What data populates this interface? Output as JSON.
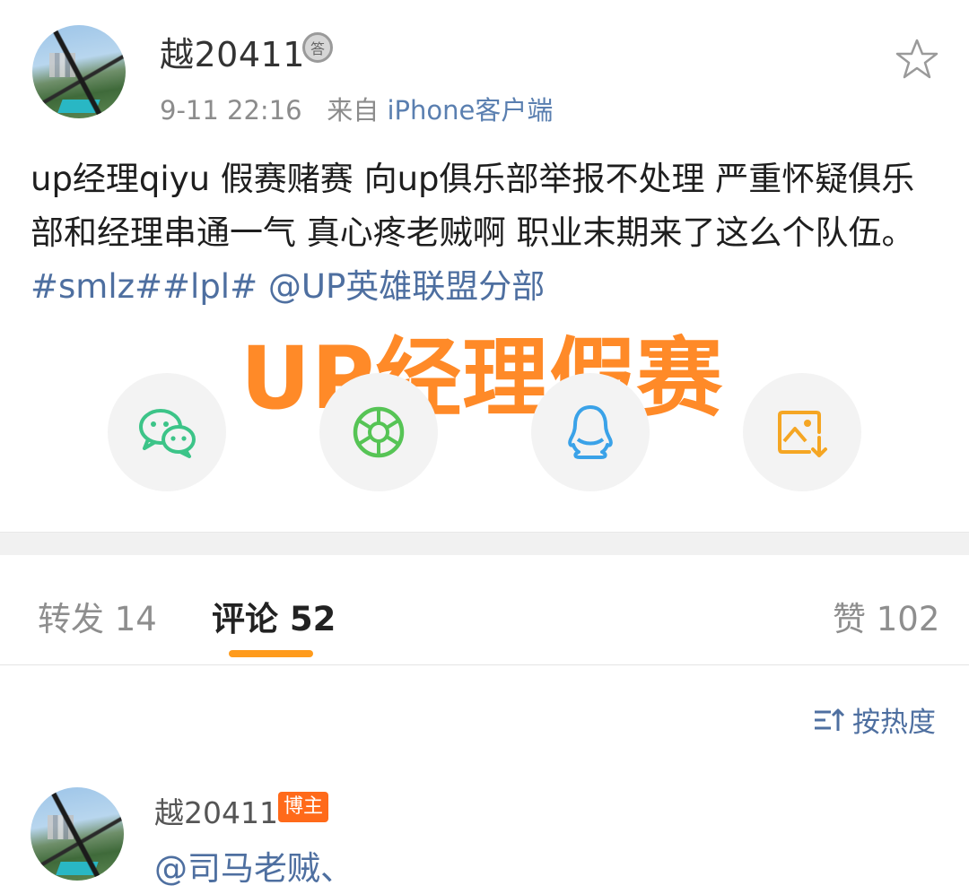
{
  "post": {
    "username": "越20411",
    "medal_glyph": "答",
    "time": "9-11 22:16",
    "source_prefix": "来自",
    "source": "iPhone客户端",
    "text_plain": "up经理qiyu 假赛赌赛 向up俱乐部举报不处理 严重怀疑俱乐部和经理串通一气 真心疼老贼啊 职业末期来了这么个队伍。",
    "tag1": "#smlz#",
    "tag2": "#lpl#",
    "mention": "@UP英雄联盟分部"
  },
  "watermark": "UP经理假赛",
  "share": {
    "items": [
      {
        "icon": "wechat-icon"
      },
      {
        "icon": "moments-icon"
      },
      {
        "icon": "qq-icon"
      },
      {
        "icon": "save-image-icon"
      }
    ]
  },
  "tabs": {
    "repost": "转发 14",
    "comments": "评论 52",
    "likes": "赞 102"
  },
  "sort_label": "按热度",
  "comment": {
    "username": "越20411",
    "badge": "博主",
    "text": "@司马老贼、"
  },
  "colors": {
    "link": "#4e6fa0",
    "accent": "#ff9b1c",
    "watermark": "#ff8a28",
    "badge": "#ff6a1a",
    "wechat": "#3cc488",
    "moments": "#56c455",
    "qq": "#3aa2e8",
    "save": "#f5a623"
  }
}
